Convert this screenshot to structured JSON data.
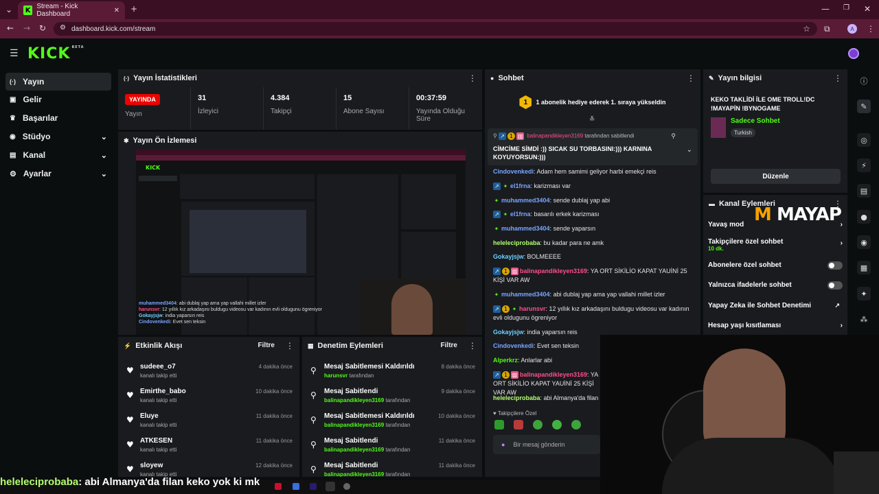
{
  "browser": {
    "tab_title": "Stream - Kick Dashboard",
    "url": "dashboard.kick.com/stream",
    "profile_initial": "A"
  },
  "brand": {
    "logo": "KICK",
    "beta": "BETA"
  },
  "sidebar": {
    "items": [
      {
        "label": "Yayın",
        "icon": "broadcast-icon"
      },
      {
        "label": "Gelir",
        "icon": "money-icon"
      },
      {
        "label": "Başarılar",
        "icon": "trophy-icon"
      },
      {
        "label": "Stüdyo",
        "icon": "studio-icon"
      },
      {
        "label": "Kanal",
        "icon": "channel-icon"
      },
      {
        "label": "Ayarlar",
        "icon": "gear-icon"
      }
    ]
  },
  "stats": {
    "title": "Yayın İstatistikleri",
    "live_badge": "YAYINDA",
    "live_label": "Yayın",
    "viewers_value": "31",
    "viewers_label": "İzleyici",
    "followers_value": "4.384",
    "followers_label": "Takipçi",
    "subs_value": "15",
    "subs_label": "Abone Sayısı",
    "uptime_value": "00:37:59",
    "uptime_label": "Yayında Olduğu Süre"
  },
  "preview": {
    "title": "Yayın Ön İzlemesi"
  },
  "activity": {
    "title": "Etkinlik Akışı",
    "filter": "Filtre",
    "rows": [
      {
        "name": "sudeee_o7",
        "action": "kanalı takip etti",
        "time": "4 dakika önce"
      },
      {
        "name": "Emirthe_babo",
        "action": "kanalı takip etti",
        "time": "10 dakika önce"
      },
      {
        "name": "Eluye",
        "action": "kanalı takip etti",
        "time": "11 dakika önce"
      },
      {
        "name": "ATKESEN",
        "action": "kanalı takip etti",
        "time": "11 dakika önce"
      },
      {
        "name": "sloyew",
        "action": "kanalı takip etti",
        "time": "12 dakika önce"
      }
    ]
  },
  "moderation": {
    "title": "Denetim Eylemleri",
    "filter": "Filtre",
    "rows": [
      {
        "action": "Mesaj Sabitlemesi Kaldırıldı",
        "user": "harunsvr",
        "suffix": "tarafından",
        "time": "8 dakika önce"
      },
      {
        "action": "Mesaj Sabitlendi",
        "user": "balinapandikleyen3169",
        "suffix": "tarafından",
        "time": "9 dakika önce"
      },
      {
        "action": "Mesaj Sabitlemesi Kaldırıldı",
        "user": "balinapandikleyen3169",
        "suffix": "tarafından",
        "time": "10 dakika önce"
      },
      {
        "action": "Mesaj Sabitlendi",
        "user": "balinapandikleyen3169",
        "suffix": "tarafından",
        "time": "11 dakika önce"
      },
      {
        "action": "Mesaj Sabitlendi",
        "user": "balinapandikleyen3169",
        "suffix": "tarafından",
        "time": "11 dakika önce"
      }
    ]
  },
  "chat": {
    "title": "Sohbet",
    "gift_banner": "1 abonelik hediye ederek 1. sıraya yükseldin",
    "pinned_by_user": "balinapandikleyen3169",
    "pinned_by_suffix": "tarafından sabitlendi",
    "pinned_text": "CİMCİME SİMDİ :)) SICAK SU TORBASINI:))) KARNINA KOYUYORSUN:)))",
    "messages": [
      {
        "user": "Cindovenkedi",
        "color": "#7aa5ff",
        "text": "Adam hem samimi geliyor harbi emekçi reis",
        "badges": []
      },
      {
        "user": "el1frna",
        "color": "#7aa5ff",
        "text": "karizması var",
        "badges": [
          "blue",
          "green"
        ]
      },
      {
        "user": "muhammed3404",
        "color": "#7aa5ff",
        "text": "sende dublaj yap abi",
        "badges": [
          "green"
        ]
      },
      {
        "user": "el1frna",
        "color": "#7aa5ff",
        "text": "basarılı erkek karizması",
        "badges": [
          "blue",
          "green"
        ]
      },
      {
        "user": "muhammed3404",
        "color": "#7aa5ff",
        "text": "sende yaparsın",
        "badges": [
          "green"
        ]
      },
      {
        "user": "heleleciprobaba",
        "color": "#b4ff6e",
        "text": "bu kadar para ne amk",
        "badges": []
      },
      {
        "user": "Gokayjsjw",
        "color": "#6ed0ff",
        "text": "BOLMEEEE",
        "badges": []
      },
      {
        "user": "balinapandikleyen3169",
        "color": "#ff4d8a",
        "text": "YA ORT SİKİLİO KAPAT YAUİNİ 25 KİŞİ VAR AW",
        "badges": [
          "blue",
          "gold",
          "pink"
        ]
      },
      {
        "user": "muhammed3404",
        "color": "#7aa5ff",
        "text": "abi dublaj yap ama yap vallahi millet izler",
        "badges": [
          "green"
        ]
      },
      {
        "user": "harunsvr",
        "color": "#ff4d8a",
        "text": "12 yıllık kız arkadaşını buldugu videosu var kadının evli oldugunu ögreniyor",
        "badges": [
          "blue",
          "gold",
          "green"
        ]
      },
      {
        "user": "Gokayjsjw",
        "color": "#6ed0ff",
        "text": "india yaparsın reis",
        "badges": []
      },
      {
        "user": "Cindovenkedi",
        "color": "#7aa5ff",
        "text": "Evet sen teksin",
        "badges": []
      },
      {
        "user": "Alperkrz",
        "color": "#53fc18",
        "text": "Anlarlar abi",
        "badges": []
      },
      {
        "user": "balinapandikleyen3169",
        "color": "#ff4d8a",
        "text": "YA ORT SİKİLİO KAPAT YAUİNİ 25 KİŞİ VAR AW",
        "badges": [
          "blue",
          "gold",
          "pink"
        ]
      },
      {
        "user": "heleleciprobaba",
        "color": "#b4ff6e",
        "text": "abi Almanya'da filan",
        "badges": []
      }
    ],
    "followers_only": "Takipçilere Özel",
    "input_placeholder": "Bir mesaj gönderin"
  },
  "stream_info": {
    "title": "Yayın bilgisi",
    "stream_title": "KEKO TAKLİDİ İLE OME TROLL!DC !MAYAPİN !BYNOGAME",
    "category": "Sadece Sohbet",
    "language": "Turkish",
    "edit_button": "Düzenle"
  },
  "channel_actions": {
    "title": "Kanal Eylemleri",
    "watermark": "MAYAP",
    "items": [
      {
        "label": "Yavaş mod",
        "sub": "",
        "control": "chevron"
      },
      {
        "label": "Takipçilere özel sohbet",
        "sub": "10 dk.",
        "control": "chevron"
      },
      {
        "label": "Abonelere özel sohbet",
        "sub": "",
        "control": "toggle"
      },
      {
        "label": "Yalnızca ifadelerle sohbet",
        "sub": "",
        "control": "toggle"
      },
      {
        "label": "Yapay Zeka ile Sohbet Denetimi",
        "sub": "",
        "control": "external"
      },
      {
        "label": "Hesap yaşı kısıtlaması",
        "sub": "",
        "control": "chevron"
      }
    ]
  },
  "caption": {
    "user": "heleleciprobaba",
    "text": ": abi Almanya'da filan keko yok ki mk"
  },
  "colors": {
    "brand": "#53fc18",
    "live": "#eb0400",
    "panel": "#191b1f",
    "chrome": "#5a1b36"
  }
}
